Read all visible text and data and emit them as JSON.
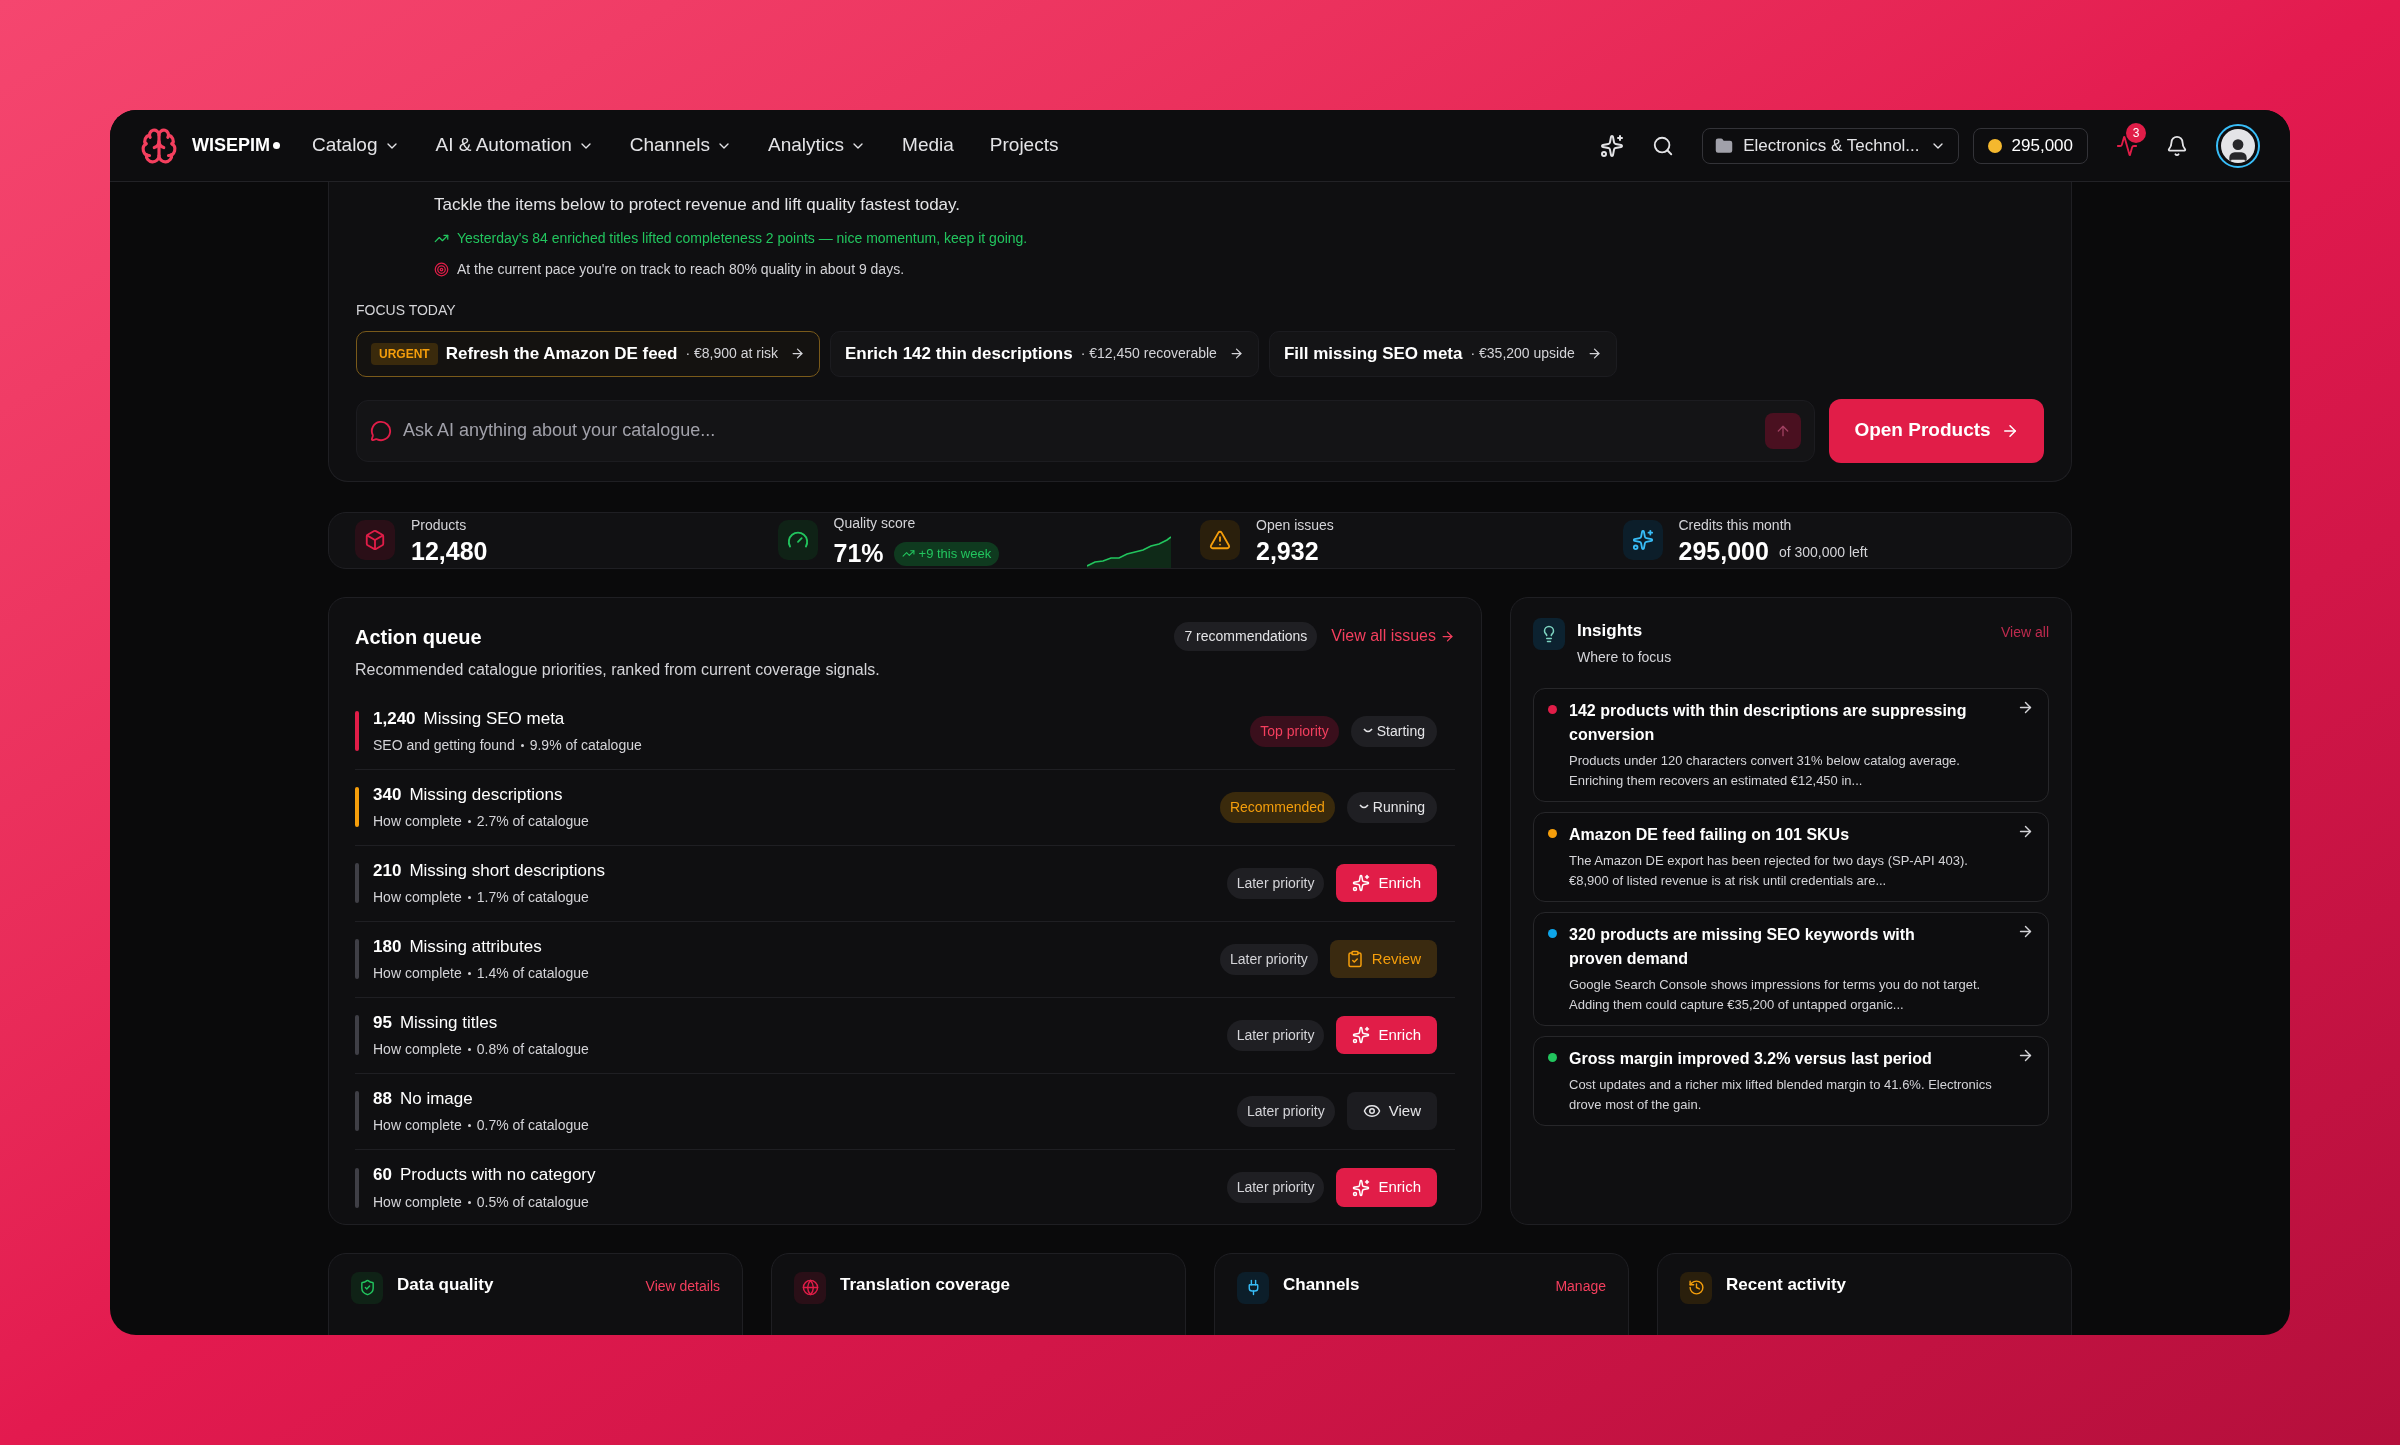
{
  "nav": {
    "brand": "WISEPIM",
    "menus": [
      {
        "label": "Catalog",
        "has_menu": true
      },
      {
        "label": "AI & Automation",
        "has_menu": true
      },
      {
        "label": "Channels",
        "has_menu": true
      },
      {
        "label": "Analytics",
        "has_menu": true
      },
      {
        "label": "Media",
        "has_menu": false
      },
      {
        "label": "Projects",
        "has_menu": false
      }
    ],
    "workspace": "Electronics & Technol...",
    "credits": "295,000",
    "alerts_badge": "3"
  },
  "hero": {
    "lead": "Tackle the items below to protect revenue and lift quality fastest today.",
    "momentum": "Yesterday's 84 enriched titles lifted completeness 2 points — nice momentum, keep it going.",
    "pace": "At the current pace you're on track to reach 80% quality in about 9 days.",
    "focus_label": "FOCUS TODAY",
    "focus_items": [
      {
        "tag": "URGENT",
        "title": "Refresh the Amazon DE feed",
        "detail": "· €8,900 at risk",
        "urgent": true
      },
      {
        "title": "Enrich 142 thin descriptions",
        "detail": "· €12,450 recoverable",
        "urgent": false
      },
      {
        "title": "Fill missing SEO meta",
        "detail": "· €35,200 upside",
        "urgent": false
      }
    ],
    "ask": {
      "placeholder": "Ask AI anything about your catalogue..."
    },
    "open_button": "Open Products"
  },
  "stats": [
    {
      "kind": "products",
      "label": "Products",
      "value": "12,480"
    },
    {
      "kind": "quality",
      "label": "Quality score",
      "value": "71%",
      "delta": "+9 this week"
    },
    {
      "kind": "issues",
      "label": "Open issues",
      "value": "2,932"
    },
    {
      "kind": "credits",
      "label": "Credits this month",
      "value": "295,000",
      "extra": "of 300,000 left"
    }
  ],
  "action_queue": {
    "title": "Action queue",
    "subtitle": "Recommended catalogue priorities, ranked from current coverage signals.",
    "count": "7 recommendations",
    "view_all": "View all issues",
    "rows": [
      {
        "count": "1,240",
        "title": "Missing SEO meta",
        "area": "SEO and getting found",
        "share": "9.9% of catalogue",
        "priority": {
          "kind": "top",
          "label": "Top priority"
        },
        "action": {
          "kind": "status",
          "label": "Starting"
        }
      },
      {
        "count": "340",
        "title": "Missing descriptions",
        "area": "How complete",
        "share": "2.7% of catalogue",
        "priority": {
          "kind": "recommended",
          "label": "Recommended"
        },
        "action": {
          "kind": "status",
          "label": "Running"
        }
      },
      {
        "count": "210",
        "title": "Missing short descriptions",
        "area": "How complete",
        "share": "1.7% of catalogue",
        "priority": {
          "kind": "later",
          "label": "Later priority"
        },
        "action": {
          "kind": "enrich",
          "label": "Enrich"
        }
      },
      {
        "count": "180",
        "title": "Missing attributes",
        "area": "How complete",
        "share": "1.4% of catalogue",
        "priority": {
          "kind": "later",
          "label": "Later priority"
        },
        "action": {
          "kind": "review",
          "label": "Review"
        }
      },
      {
        "count": "95",
        "title": "Missing titles",
        "area": "How complete",
        "share": "0.8% of catalogue",
        "priority": {
          "kind": "later",
          "label": "Later priority"
        },
        "action": {
          "kind": "enrich",
          "label": "Enrich"
        }
      },
      {
        "count": "88",
        "title": "No image",
        "area": "How complete",
        "share": "0.7% of catalogue",
        "priority": {
          "kind": "later",
          "label": "Later priority"
        },
        "action": {
          "kind": "view",
          "label": "View"
        }
      },
      {
        "count": "60",
        "title": "Products with no category",
        "area": "How complete",
        "share": "0.5% of catalogue",
        "priority": {
          "kind": "later",
          "label": "Later priority"
        },
        "action": {
          "kind": "enrich",
          "label": "Enrich"
        }
      }
    ]
  },
  "insights": {
    "title": "Insights",
    "subtitle": "Where to focus",
    "view_all": "View all",
    "items": [
      {
        "title": "142 products with thin descriptions are suppressing conversion",
        "body": "Products under 120 characters convert 31% below catalog average. Enriching them recovers an estimated €12,450 in...",
        "color": "#e11d48"
      },
      {
        "title": "Amazon DE feed failing on 101 SKUs",
        "body": "The Amazon DE export has been rejected for two days (SP-API 403). €8,900 of listed revenue is at risk until credentials are...",
        "color": "#f59e0b"
      },
      {
        "title": "320 products are missing SEO keywords with proven demand",
        "body": "Google Search Console shows impressions for terms you do not target. Adding them could capture €35,200 of untapped organic...",
        "color": "#0ea5e9"
      },
      {
        "title": "Gross margin improved 3.2% versus last period",
        "body": "Cost updates and a richer mix lifted blended margin to 41.6%. Electronics drove most of the gain.",
        "color": "#22c55e"
      }
    ]
  },
  "bottom_cards": [
    {
      "kind": "quality",
      "title": "Data quality",
      "link": "View details"
    },
    {
      "kind": "translation",
      "title": "Translation coverage"
    },
    {
      "kind": "channels",
      "title": "Channels",
      "link": "Manage"
    },
    {
      "kind": "activity",
      "title": "Recent activity"
    }
  ]
}
